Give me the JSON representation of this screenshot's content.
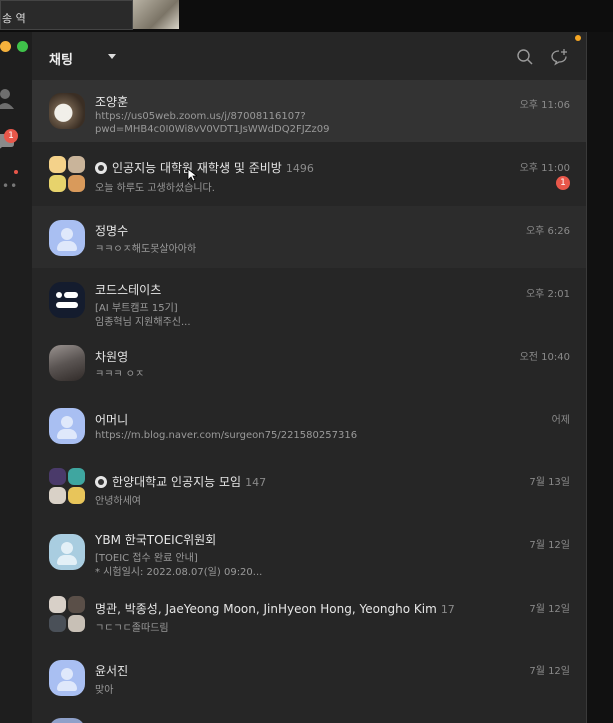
{
  "camera": {
    "name_label": "송 역"
  },
  "header": {
    "title": "채팅"
  },
  "rail": {
    "badge": "1"
  },
  "chats": [
    {
      "name": "조양훈",
      "message": "https://us05web.zoom.us/j/87008116107?",
      "message2": "pwd=MHB4c0I0Wi8vV0VDT1JsWWdDQ2FJZz09",
      "time": "오후 11:06"
    },
    {
      "name": "인공지능 대학원 재학생 및 준비방",
      "count": "1496",
      "message": "오늘 하루도 고생하셨습니다.",
      "time": "오후 11:00",
      "badge": "1"
    },
    {
      "name": "정명수",
      "message": "ㅋㅋㅇㅈ해도못살아아하",
      "time": "오후 6:26"
    },
    {
      "name": "코드스테이츠",
      "message": "[AI 부트캠프 15기]",
      "message2": "임종혁님 지원해주신...",
      "time": "오후 2:01"
    },
    {
      "name": "차원영",
      "message": "ㅋㅋㅋ ㅇㅈ",
      "time": "오전 10:40"
    },
    {
      "name": "어머니",
      "message": "https://m.blog.naver.com/surgeon75/221580257316",
      "time": "어제"
    },
    {
      "name": "한양대학교 인공지능 모임",
      "count": "147",
      "message": "안녕하세여",
      "time": "7월 13일"
    },
    {
      "name": "YBM 한국TOEIC위원회",
      "message": "[TOEIC 접수 완료 안내]",
      "message2": "* 시험일시: 2022.08.07(일) 09:20...",
      "time": "7월 12일"
    },
    {
      "name": "명관, 박종성, JaeYeong Moon, JinHyeon Hong, Yeongho Kim",
      "count": "17",
      "message": "ㄱㄷㄱㄷ졸따드림",
      "time": "7월 12일"
    },
    {
      "name": "윤서진",
      "message": "맞아",
      "time": "7월 12일"
    }
  ]
}
